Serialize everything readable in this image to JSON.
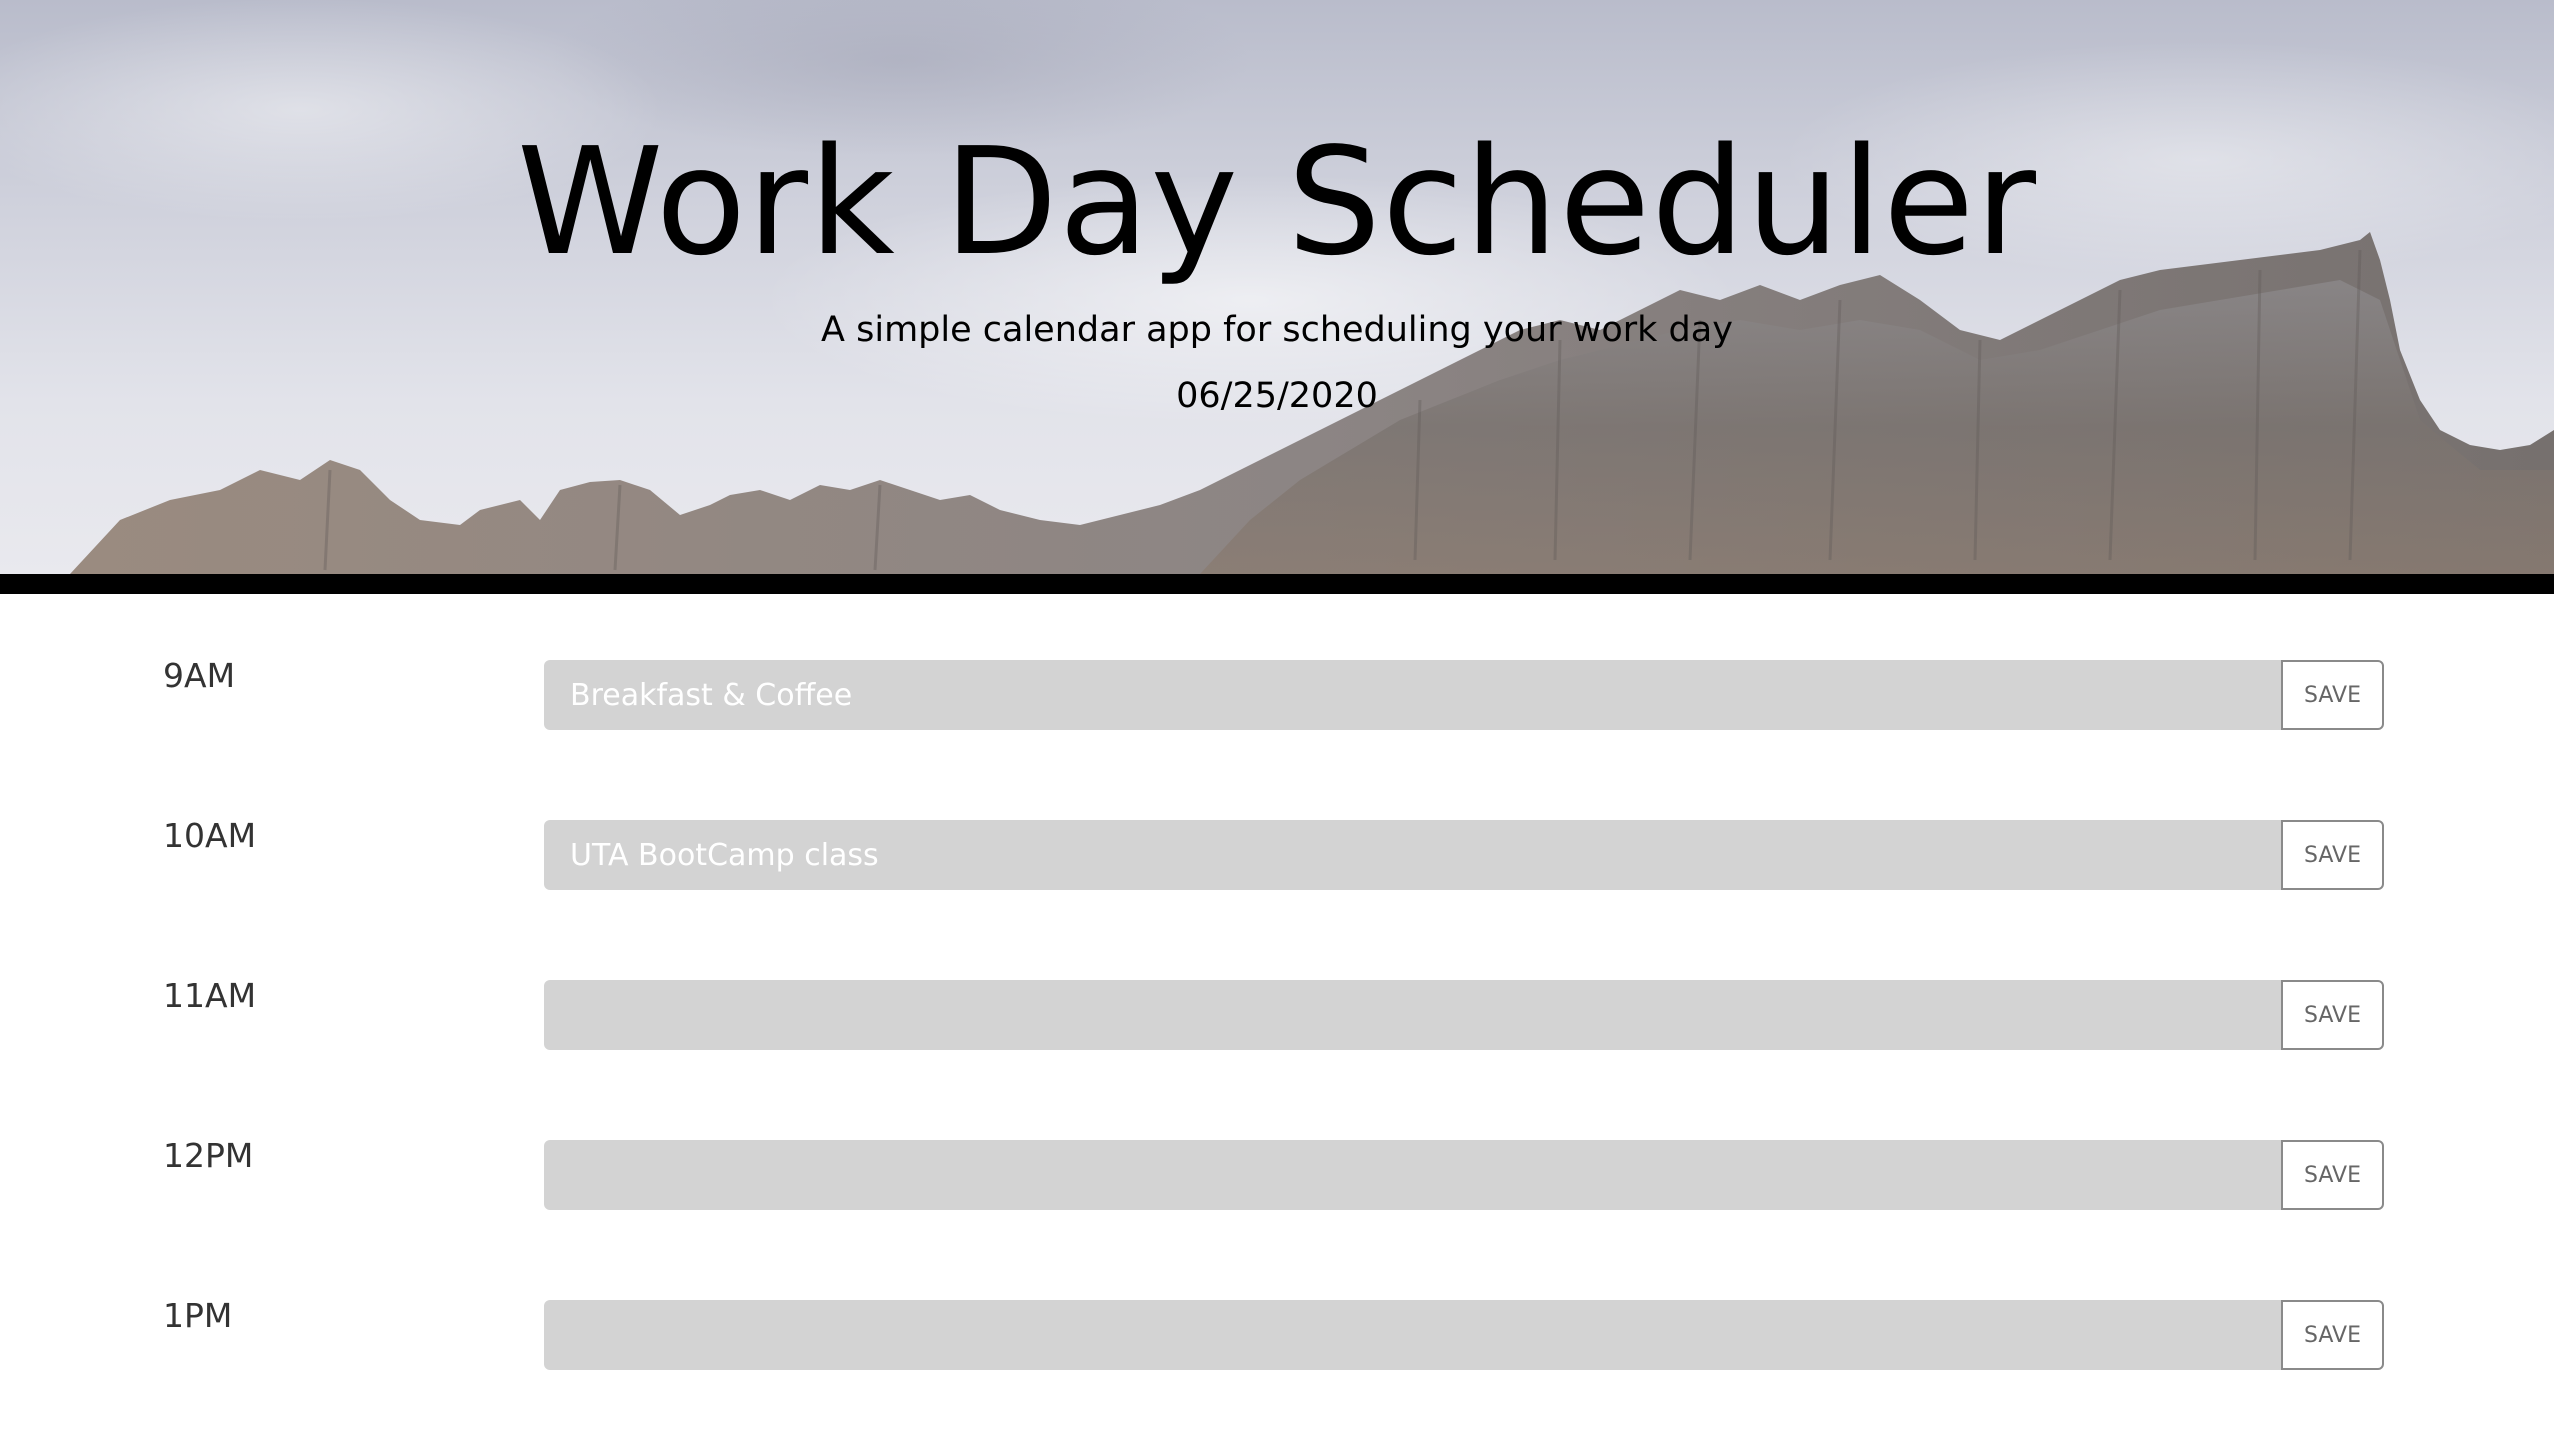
{
  "header": {
    "title": "Work Day Scheduler",
    "subtitle": "A simple calendar app for scheduling your work day",
    "date": "06/25/2020"
  },
  "rows": [
    {
      "hour": "9AM",
      "task": "Breakfast & Coffee",
      "save_label": "SAVE"
    },
    {
      "hour": "10AM",
      "task": "UTA BootCamp class",
      "save_label": "SAVE"
    },
    {
      "hour": "11AM",
      "task": "",
      "save_label": "SAVE"
    },
    {
      "hour": "12PM",
      "task": "",
      "save_label": "SAVE"
    },
    {
      "hour": "1PM",
      "task": "",
      "save_label": "SAVE"
    }
  ],
  "colors": {
    "task_background": "#d3d3d3",
    "header_border": "#000000",
    "save_border": "#8a8a8a"
  }
}
